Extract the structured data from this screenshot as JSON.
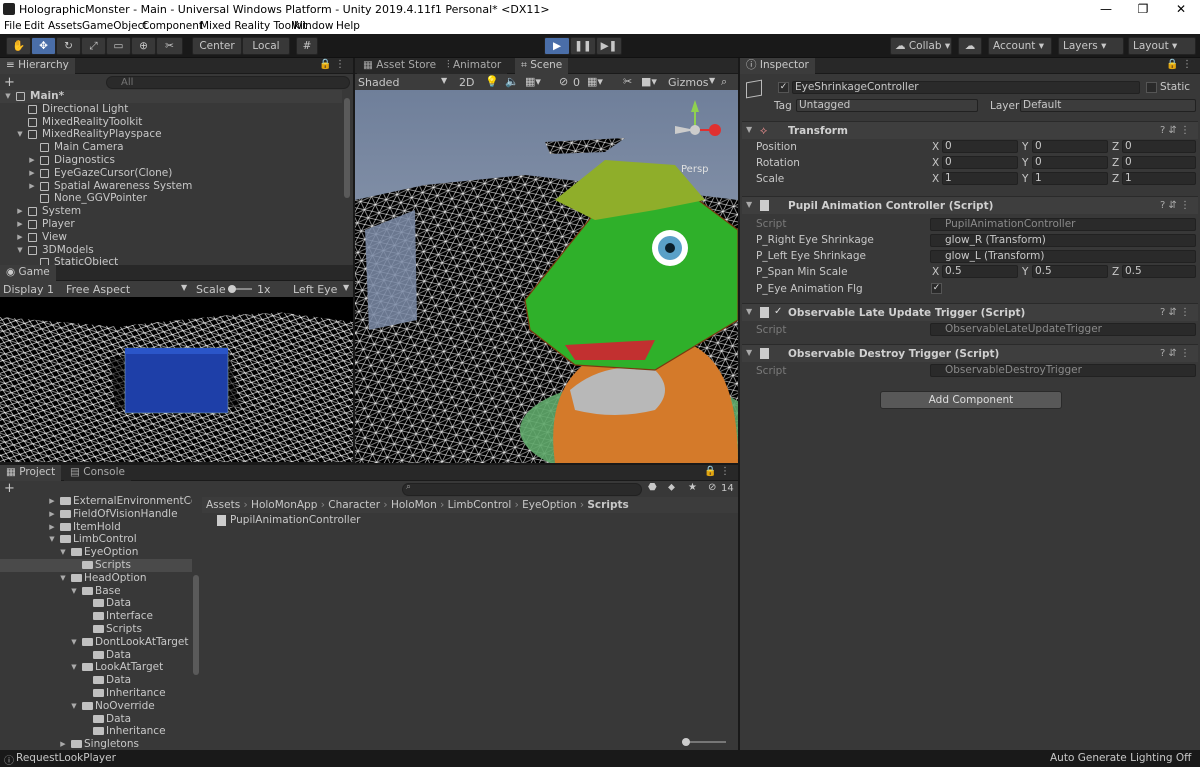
{
  "window": {
    "title": "HolographicMonster - Main - Universal Windows Platform - Unity 2019.4.11f1 Personal* <DX11>",
    "min": "—",
    "max": "❐",
    "close": "✕"
  },
  "menu": [
    "File",
    "Edit",
    "Assets",
    "GameObject",
    "Component",
    "Mixed Reality Toolkit",
    "Window",
    "Help"
  ],
  "toolbar": {
    "center": "Center",
    "local": "Local",
    "collab": "Collab",
    "account": "Account",
    "layers": "Layers",
    "layout": "Layout",
    "play": "▶",
    "pause": "❚❚",
    "step": "▶❚"
  },
  "hierarchy": {
    "tab": "Hierarchy",
    "search_placeholder": "All",
    "add": "+",
    "items": [
      {
        "label": "Main*",
        "depth": 0,
        "arrow": "▼",
        "kind": "scene"
      },
      {
        "label": "Directional Light",
        "depth": 1,
        "arrow": "",
        "kind": "obj"
      },
      {
        "label": "MixedRealityToolkit",
        "depth": 1,
        "arrow": "",
        "kind": "obj"
      },
      {
        "label": "MixedRealityPlayspace",
        "depth": 1,
        "arrow": "▼",
        "kind": "obj"
      },
      {
        "label": "Main Camera",
        "depth": 2,
        "arrow": "",
        "kind": "obj"
      },
      {
        "label": "Diagnostics",
        "depth": 2,
        "arrow": "▶",
        "kind": "obj"
      },
      {
        "label": "EyeGazeCursor(Clone)",
        "depth": 2,
        "arrow": "▶",
        "kind": "obj"
      },
      {
        "label": "Spatial Awareness System",
        "depth": 2,
        "arrow": "▶",
        "kind": "obj"
      },
      {
        "label": "None_GGVPointer",
        "depth": 2,
        "arrow": "",
        "kind": "obj"
      },
      {
        "label": "System",
        "depth": 1,
        "arrow": "▶",
        "kind": "obj"
      },
      {
        "label": "Player",
        "depth": 1,
        "arrow": "▶",
        "kind": "obj"
      },
      {
        "label": "View",
        "depth": 1,
        "arrow": "▶",
        "kind": "obj"
      },
      {
        "label": "3DModels",
        "depth": 1,
        "arrow": "▼",
        "kind": "obj"
      },
      {
        "label": "StaticObject",
        "depth": 2,
        "arrow": "",
        "kind": "obj"
      }
    ]
  },
  "game": {
    "tab": "Game",
    "display": "Display 1",
    "aspect": "Free Aspect",
    "scale_label": "Scale",
    "scale_value": "1x",
    "eye": "Left Eye"
  },
  "scene": {
    "tabs": [
      "Asset Store",
      "Animator",
      "Scene"
    ],
    "shading": "Shaded",
    "mode2d": "2D",
    "gizmos": "Gizmos",
    "persp": "Persp",
    "hidden_count": "0"
  },
  "project": {
    "tabs": [
      "Project",
      "Console"
    ],
    "add": "+",
    "hidden_count": "14",
    "breadcrumb": [
      "Assets",
      "HoloMonApp",
      "Character",
      "HoloMon",
      "LimbControl",
      "EyeOption",
      "Scripts"
    ],
    "files": [
      "PupilAnimationController"
    ],
    "tree": [
      {
        "label": "ExternalEnvironmentConti",
        "depth": 0,
        "arrow": "▶"
      },
      {
        "label": "FieldOfVisionHandle",
        "depth": 0,
        "arrow": "▶"
      },
      {
        "label": "ItemHold",
        "depth": 0,
        "arrow": "▶"
      },
      {
        "label": "LimbControl",
        "depth": 0,
        "arrow": "▼"
      },
      {
        "label": "EyeOption",
        "depth": 1,
        "arrow": "▼"
      },
      {
        "label": "Scripts",
        "depth": 2,
        "arrow": "",
        "selected": true
      },
      {
        "label": "HeadOption",
        "depth": 1,
        "arrow": "▼"
      },
      {
        "label": "Base",
        "depth": 2,
        "arrow": "▼"
      },
      {
        "label": "Data",
        "depth": 3,
        "arrow": ""
      },
      {
        "label": "Interface",
        "depth": 3,
        "arrow": ""
      },
      {
        "label": "Scripts",
        "depth": 3,
        "arrow": ""
      },
      {
        "label": "DontLookAtTarget",
        "depth": 2,
        "arrow": "▼"
      },
      {
        "label": "Data",
        "depth": 3,
        "arrow": ""
      },
      {
        "label": "LookAtTarget",
        "depth": 2,
        "arrow": "▼"
      },
      {
        "label": "Data",
        "depth": 3,
        "arrow": ""
      },
      {
        "label": "Inheritance",
        "depth": 3,
        "arrow": ""
      },
      {
        "label": "NoOverride",
        "depth": 2,
        "arrow": "▼"
      },
      {
        "label": "Data",
        "depth": 3,
        "arrow": ""
      },
      {
        "label": "Inheritance",
        "depth": 3,
        "arrow": ""
      },
      {
        "label": "Singletons",
        "depth": 1,
        "arrow": "▶"
      }
    ]
  },
  "inspector": {
    "tab": "Inspector",
    "object_name": "EyeShrinkageController",
    "static_label": "Static",
    "tag_label": "Tag",
    "tag_value": "Untagged",
    "layer_label": "Layer",
    "layer_value": "Default",
    "transform": {
      "title": "Transform",
      "rows": [
        {
          "label": "Position",
          "x": "0",
          "y": "0",
          "z": "0"
        },
        {
          "label": "Rotation",
          "x": "0",
          "y": "0",
          "z": "0"
        },
        {
          "label": "Scale",
          "x": "1",
          "y": "1",
          "z": "1"
        }
      ]
    },
    "pupil": {
      "title": "Pupil Animation Controller (Script)",
      "script_label": "Script",
      "script_value": "PupilAnimationController",
      "right_label": "P_Right Eye Shrinkage",
      "right_value": "glow_R (Transform)",
      "left_label": "P_Left Eye Shrinkage",
      "left_value": "glow_L (Transform)",
      "span_label": "P_Span Min Scale",
      "span_x": "0.5",
      "span_y": "0.5",
      "span_z": "0.5",
      "flag_label": "P_Eye Animation Flg"
    },
    "late": {
      "title": "Observable Late Update Trigger (Script)",
      "script_label": "Script",
      "script_value": "ObservableLateUpdateTrigger"
    },
    "destroy": {
      "title": "Observable Destroy Trigger (Script)",
      "script_label": "Script",
      "script_value": "ObservableDestroyTrigger"
    },
    "add_component": "Add Component",
    "axis": {
      "x": "X",
      "y": "Y",
      "z": "Z"
    }
  },
  "status": {
    "left": "RequestLookPlayer",
    "right": "Auto Generate Lighting Off"
  }
}
